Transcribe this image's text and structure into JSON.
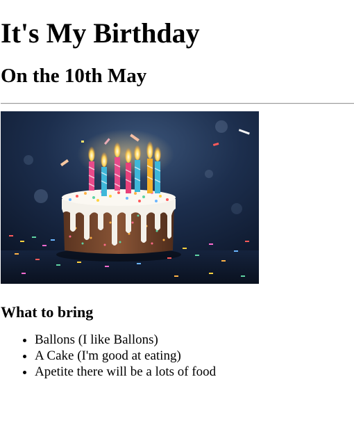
{
  "page": {
    "title": "It's My Birthday",
    "subtitle": "On the 10th May",
    "image_alt": "Birthday cake with lit candles",
    "section_heading": "What to bring",
    "items": [
      "Ballons (I like Ballons)",
      "A Cake (I'm good at eating)",
      "Apetite there will be a lots of food"
    ]
  },
  "colors": {
    "background": "#ffffff",
    "text": "#000000",
    "rule": "#9a9a9a"
  }
}
